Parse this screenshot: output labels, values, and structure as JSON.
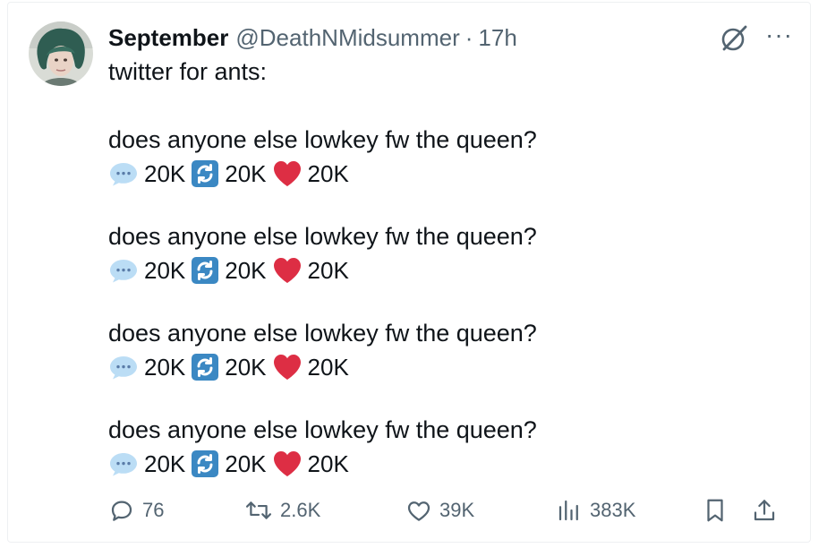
{
  "tweet": {
    "display_name": "September",
    "handle": "@DeathNMidsummer",
    "separator": "·",
    "time": "17h",
    "more_label": "···",
    "intro": "twitter for ants:",
    "blocks": [
      {
        "text": "does anyone else lowkey fw the queen?",
        "replies": "20K",
        "retweets": "20K",
        "likes": "20K"
      },
      {
        "text": "does anyone else lowkey fw the queen?",
        "replies": "20K",
        "retweets": "20K",
        "likes": "20K"
      },
      {
        "text": "does anyone else lowkey fw the queen?",
        "replies": "20K",
        "retweets": "20K",
        "likes": "20K"
      },
      {
        "text": "does anyone else lowkey fw the queen?",
        "replies": "20K",
        "retweets": "20K",
        "likes": "20K"
      }
    ],
    "actions": {
      "replies": "76",
      "reposts": "2.6K",
      "likes": "39K",
      "views": "383K"
    }
  },
  "icons": {
    "avatar": "avatar",
    "grok": "grok-icon",
    "more": "more-icon",
    "speech_bubble_emoji": "speech-balloon-emoji",
    "repeat_emoji": "repeat-arrows-emoji",
    "heart_emoji": "red-heart-emoji",
    "reply": "reply-icon",
    "repost": "repost-icon",
    "like": "like-icon",
    "views": "views-icon",
    "bookmark": "bookmark-icon",
    "share": "share-icon"
  },
  "colors": {
    "text": "#0f1419",
    "secondary": "#536471",
    "heart_emoji": "#dd2e44",
    "repeat_emoji": "#3b88c3",
    "speech_emoji": "#bbddf5"
  }
}
